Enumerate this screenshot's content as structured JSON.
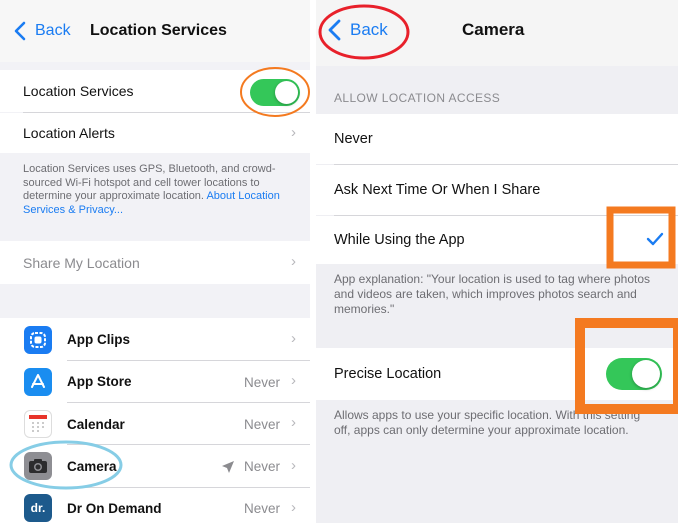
{
  "left": {
    "back_label": "Back",
    "title": "Location Services",
    "location_services_label": "Location Services",
    "location_alerts_label": "Location Alerts",
    "description": "Location Services uses GPS, Bluetooth, and crowd-sourced Wi-Fi hotspot and cell tower locations to determine your approximate location.",
    "description_link": "About Location Services & Privacy...",
    "share_my_location_label": "Share My Location",
    "apps": [
      {
        "name": "App Clips",
        "status": ""
      },
      {
        "name": "App Store",
        "status": "Never"
      },
      {
        "name": "Calendar",
        "status": "Never"
      },
      {
        "name": "Camera",
        "status": "Never"
      },
      {
        "name": "Dr On Demand",
        "status": "Never"
      }
    ],
    "dr_icon_text": "dr."
  },
  "right": {
    "back_label": "Back",
    "title": "Camera",
    "section_header": "ALLOW LOCATION ACCESS",
    "options": [
      "Never",
      "Ask Next Time Or When I Share",
      "While Using the App"
    ],
    "selected_option": "While Using the App",
    "explanation": "App explanation: \"Your location is used to tag where photos and videos are taken, which improves photos search and memories.\"",
    "precise_label": "Precise Location",
    "precise_desc": "Allows apps to use your specific location. With this setting off, apps can only determine your approximate location."
  },
  "colors": {
    "ios_blue": "#1a7cf2",
    "toggle_green": "#34c759",
    "annotation_orange": "#f47a20",
    "annotation_red": "#e8202a",
    "annotation_lightblue": "#86cde6"
  }
}
